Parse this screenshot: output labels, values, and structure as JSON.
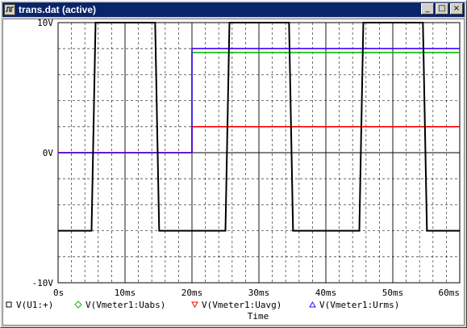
{
  "window": {
    "title": "trans.dat (active)",
    "buttons": {
      "minimize": "_",
      "restore": "□",
      "close": "×"
    }
  },
  "chart_data": {
    "type": "line",
    "xlabel": "Time",
    "ylabel": "",
    "xlim": [
      0,
      60
    ],
    "ylim": [
      -10,
      10
    ],
    "x_unit": "ms",
    "grid": true,
    "x_ticks": [
      {
        "v": 0,
        "label": "0s"
      },
      {
        "v": 10,
        "label": "10ms"
      },
      {
        "v": 20,
        "label": "20ms"
      },
      {
        "v": 30,
        "label": "30ms"
      },
      {
        "v": 40,
        "label": "40ms"
      },
      {
        "v": 50,
        "label": "50ms"
      },
      {
        "v": 60,
        "label": "60ms"
      }
    ],
    "y_ticks": [
      {
        "v": 10,
        "label": "10V"
      },
      {
        "v": 0,
        "label": "0V"
      },
      {
        "v": -10,
        "label": "-10V"
      }
    ],
    "legend_position": "bottom",
    "series": [
      {
        "name": "V(U1:+)",
        "color": "#000000",
        "marker": "square",
        "points": [
          [
            0,
            -6
          ],
          [
            5,
            -6
          ],
          [
            5.6,
            10
          ],
          [
            14.5,
            10
          ],
          [
            15.1,
            -6
          ],
          [
            25,
            -6
          ],
          [
            25.6,
            10
          ],
          [
            34.5,
            10
          ],
          [
            35.1,
            -6
          ],
          [
            45,
            -6
          ],
          [
            45.6,
            10
          ],
          [
            54.5,
            10
          ],
          [
            55.1,
            -6
          ],
          [
            60,
            -6
          ]
        ]
      },
      {
        "name": "V(Vmeter1:Uabs)",
        "color": "#00c000",
        "marker": "diamond",
        "points": [
          [
            0,
            0
          ],
          [
            20,
            0
          ],
          [
            20,
            7.7
          ],
          [
            60,
            7.7
          ]
        ]
      },
      {
        "name": "V(Vmeter1:Uavg)",
        "color": "#ff0000",
        "marker": "triangle-down",
        "points": [
          [
            0,
            0
          ],
          [
            20,
            0
          ],
          [
            20,
            2
          ],
          [
            60,
            2
          ]
        ]
      },
      {
        "name": "V(Vmeter1:Urms)",
        "color": "#4000ff",
        "marker": "triangle-up",
        "points": [
          [
            0,
            0
          ],
          [
            20,
            0
          ],
          [
            20,
            8
          ],
          [
            60,
            8
          ]
        ]
      }
    ]
  }
}
